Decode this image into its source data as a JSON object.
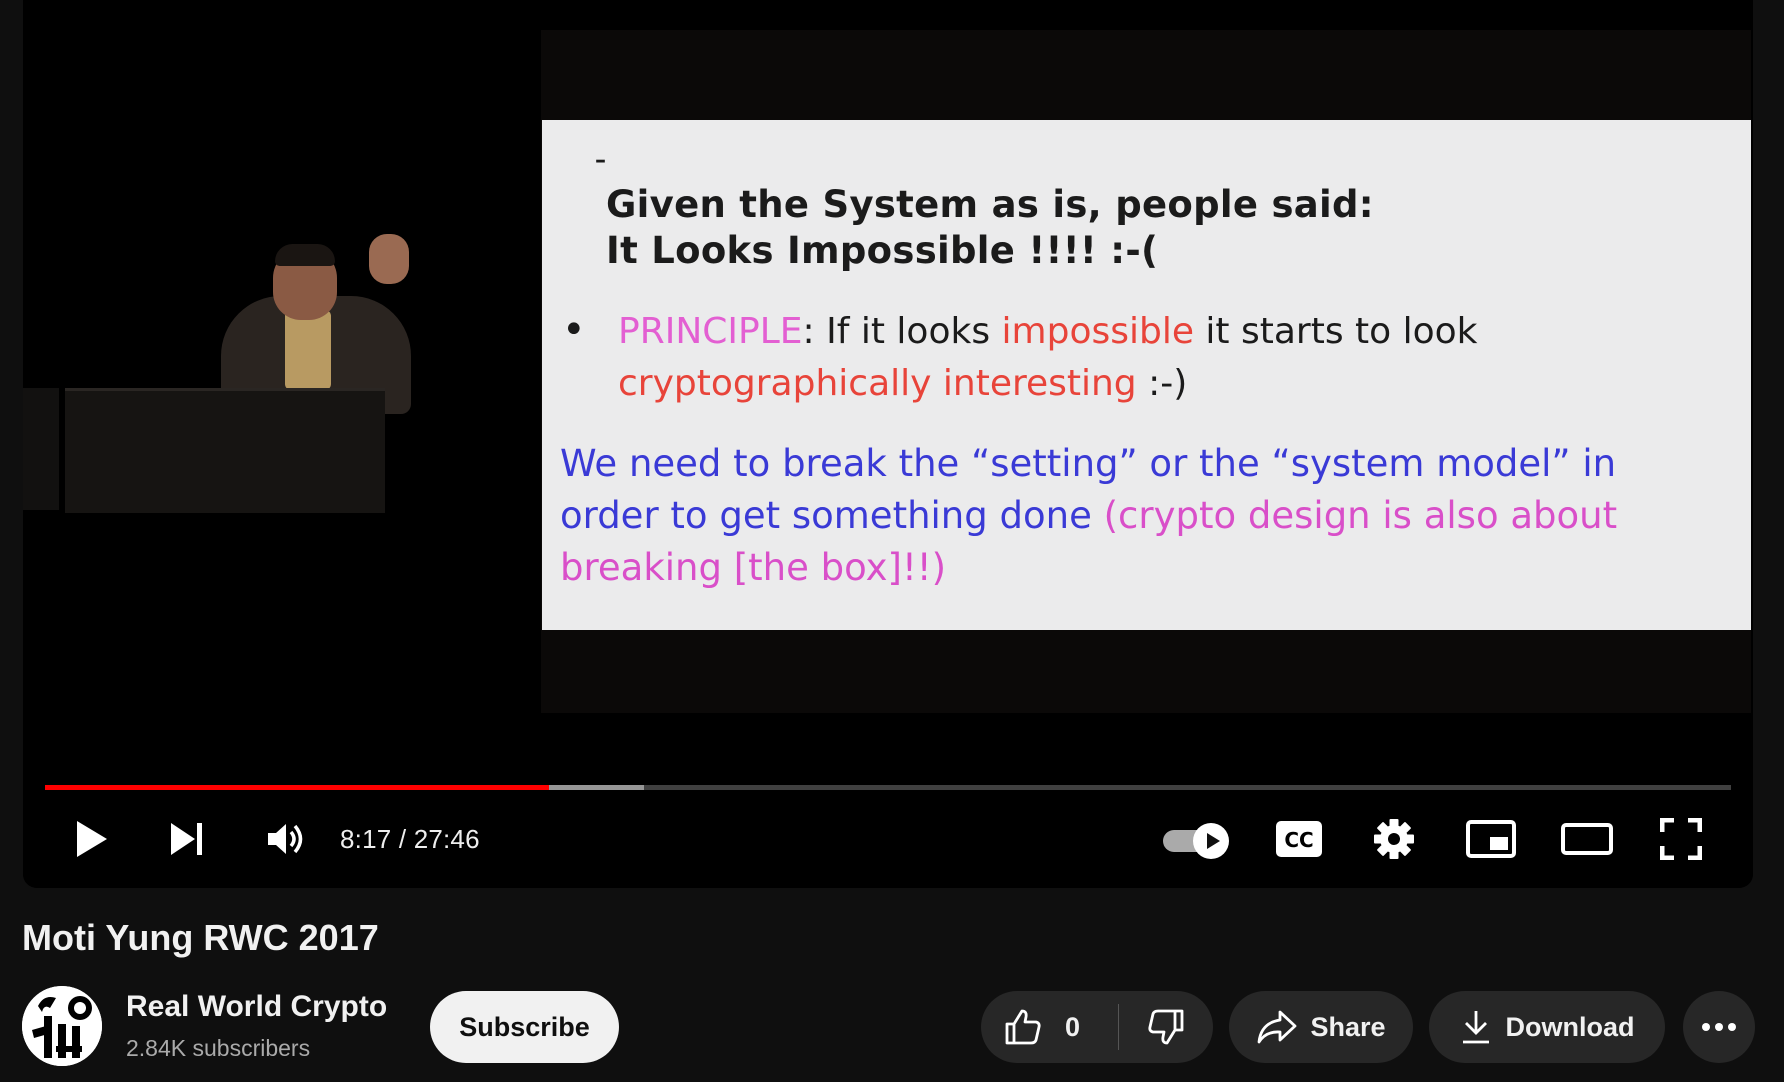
{
  "video": {
    "slide": {
      "dash": "–",
      "heading_line1": "Given the System as is, people said:",
      "heading_line2": "It Looks Impossible !!!! :-(",
      "bullet_marker": "•",
      "principle_label": "PRINCIPLE",
      "principle_part1": ": If it looks ",
      "principle_highlight1": "impossible",
      "principle_part2": " it starts to look ",
      "principle_highlight2": "cryptographically interesting",
      "principle_part3": " :-)",
      "para_blue": "We need to break the “setting” or the “system model” in order to get something done ",
      "para_magenta": "(crypto design is also about breaking [the box]!!)"
    }
  },
  "player": {
    "progress_played_fraction": 0.2989,
    "progress_buffered_fraction": 0.3555,
    "current_time": "8:17",
    "duration": "27:46",
    "time_separator": " / ",
    "colors": {
      "progress_played": "#ff0000"
    },
    "icons": [
      "play-icon",
      "next-icon",
      "volume-icon",
      "autoplay-toggle",
      "captions-icon",
      "settings-icon",
      "miniplayer-icon",
      "theater-icon",
      "fullscreen-icon"
    ],
    "captions_label": "CC"
  },
  "meta": {
    "title": "Moti Yung RWC 2017",
    "channel_name": "Real World Crypto",
    "subscribers": "2.84K subscribers",
    "subscribe_label": "Subscribe",
    "like_count": "0",
    "share_label": "Share",
    "download_label": "Download"
  }
}
